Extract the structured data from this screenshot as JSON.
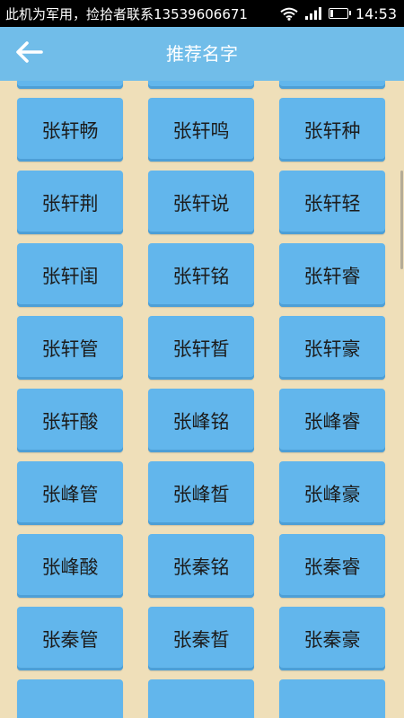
{
  "status_bar": {
    "notice": "此机为军用，捡拾者联系13539606671",
    "battery_level": "16",
    "time": "14:53"
  },
  "header": {
    "title": "推荐名字"
  },
  "names": [
    "",
    "",
    "",
    "张轩畅",
    "张轩鸣",
    "张轩种",
    "张轩荆",
    "张轩说",
    "张轩轻",
    "张轩闺",
    "张轩铭",
    "张轩睿",
    "张轩管",
    "张轩晳",
    "张轩豪",
    "张轩酸",
    "张峰铭",
    "张峰睿",
    "张峰管",
    "张峰晳",
    "张峰豪",
    "张峰酸",
    "张秦铭",
    "张秦睿",
    "张秦管",
    "张秦晳",
    "张秦豪",
    "",
    "",
    ""
  ],
  "colors": {
    "background": "#efdfb9",
    "header": "#71bde9",
    "button": "#62b6ec"
  }
}
